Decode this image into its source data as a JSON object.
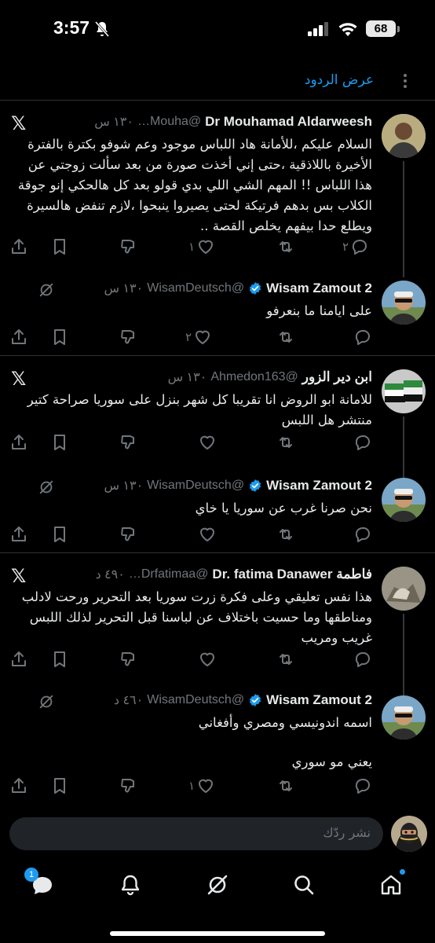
{
  "status_bar": {
    "time": "3:57",
    "battery": "68"
  },
  "top_bar": {
    "show_replies": "عرض الردود"
  },
  "threads": [
    {
      "post": {
        "name": "Dr Mouhamad Aldarweesh",
        "handle": "@Mouha…",
        "time": "١٣٠ س",
        "text": "السلام عليكم ،للأمانة هاد اللباس موجود وعم شوفو بكترة بالفترة الأخيرة باللاذقية ،حتى إني أخذت صورة من بعد سألت زوجتي عن هذا اللباس !! المهم الشي اللي بدي قولو بعد كل هالحكي إنو جوقة الكلاب بس بدهم فرتيكة لحتى يصيروا ينبحوا ،لازم تنفض هالسيرة ويطلع حدا بيفهم يخلص القصة ..",
        "replies": "٢",
        "likes": "١"
      },
      "reply": {
        "name": "Wisam Zamout 2",
        "handle": "@WisamDeutsch",
        "time": "١٣٠ س",
        "text": "على ايامنا ما بنعرفو",
        "likes": "٢"
      }
    },
    {
      "post": {
        "name": "ابن دير الزور",
        "handle": "@Ahmedon163",
        "time": "١٣٠ س",
        "text": "للامانة ابو الروض انا تقريبا كل شهر بنزل على سوريا صراحة كتير منتشر هل اللبس"
      },
      "reply": {
        "name": "Wisam Zamout 2",
        "handle": "@WisamDeutsch",
        "time": "١٣٠ س",
        "text": "نحن صرنا غرب عن سوريا يا خاي"
      }
    },
    {
      "post": {
        "name": "فاطمة Dr. fatima Danawer",
        "handle": "@Drfatimaa…",
        "time": "٤٩٠ د",
        "text": "هذا نفس تعليقي وعلى فكرة زرت سوريا بعد التحرير ورحت لادلب ومناطقها وما حسيت باختلاف عن لباسنا قبل التحرير لذلك اللبس غريب ومريب"
      },
      "reply": {
        "name": "Wisam Zamout 2",
        "handle": "@WisamDeutsch",
        "time": "٤٦٠ د",
        "text": "اسمه اندونيسي ومصري وأفغاني",
        "text2": "يعني مو سوري",
        "likes": "١"
      }
    }
  ],
  "composer": {
    "placeholder": "نشر ردّك"
  },
  "tab_bar": {
    "messages_badge": "1"
  },
  "colors": {
    "accent": "#1d9bf0",
    "muted": "#71767b",
    "text": "#e7e9ea",
    "divider": "#2f3336"
  }
}
